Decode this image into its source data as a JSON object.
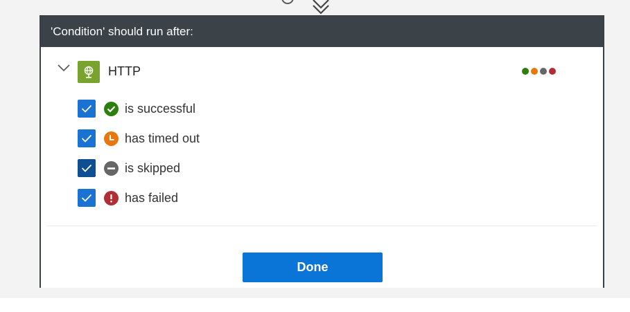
{
  "panel": {
    "title": "'Condition' should run after:"
  },
  "action": {
    "name": "HTTP",
    "icon": "globe-icon",
    "icon_color": "#7aa22e",
    "status_dot_colors": [
      "#2e7d0f",
      "#e8770e",
      "#666666",
      "#b02e35"
    ]
  },
  "options": [
    {
      "label": "is successful",
      "checked": true,
      "icon": "success-check-icon",
      "color": "#2e7d0f"
    },
    {
      "label": "has timed out",
      "checked": true,
      "icon": "clock-icon",
      "color": "#e8770e"
    },
    {
      "label": "is skipped",
      "checked": true,
      "icon": "skipped-icon",
      "color": "#666666"
    },
    {
      "label": "has failed",
      "checked": true,
      "icon": "error-icon",
      "color": "#b02e35"
    }
  ],
  "footer": {
    "done_label": "Done"
  },
  "colors": {
    "header_bg": "#3b4248",
    "accent": "#0a74d7"
  }
}
